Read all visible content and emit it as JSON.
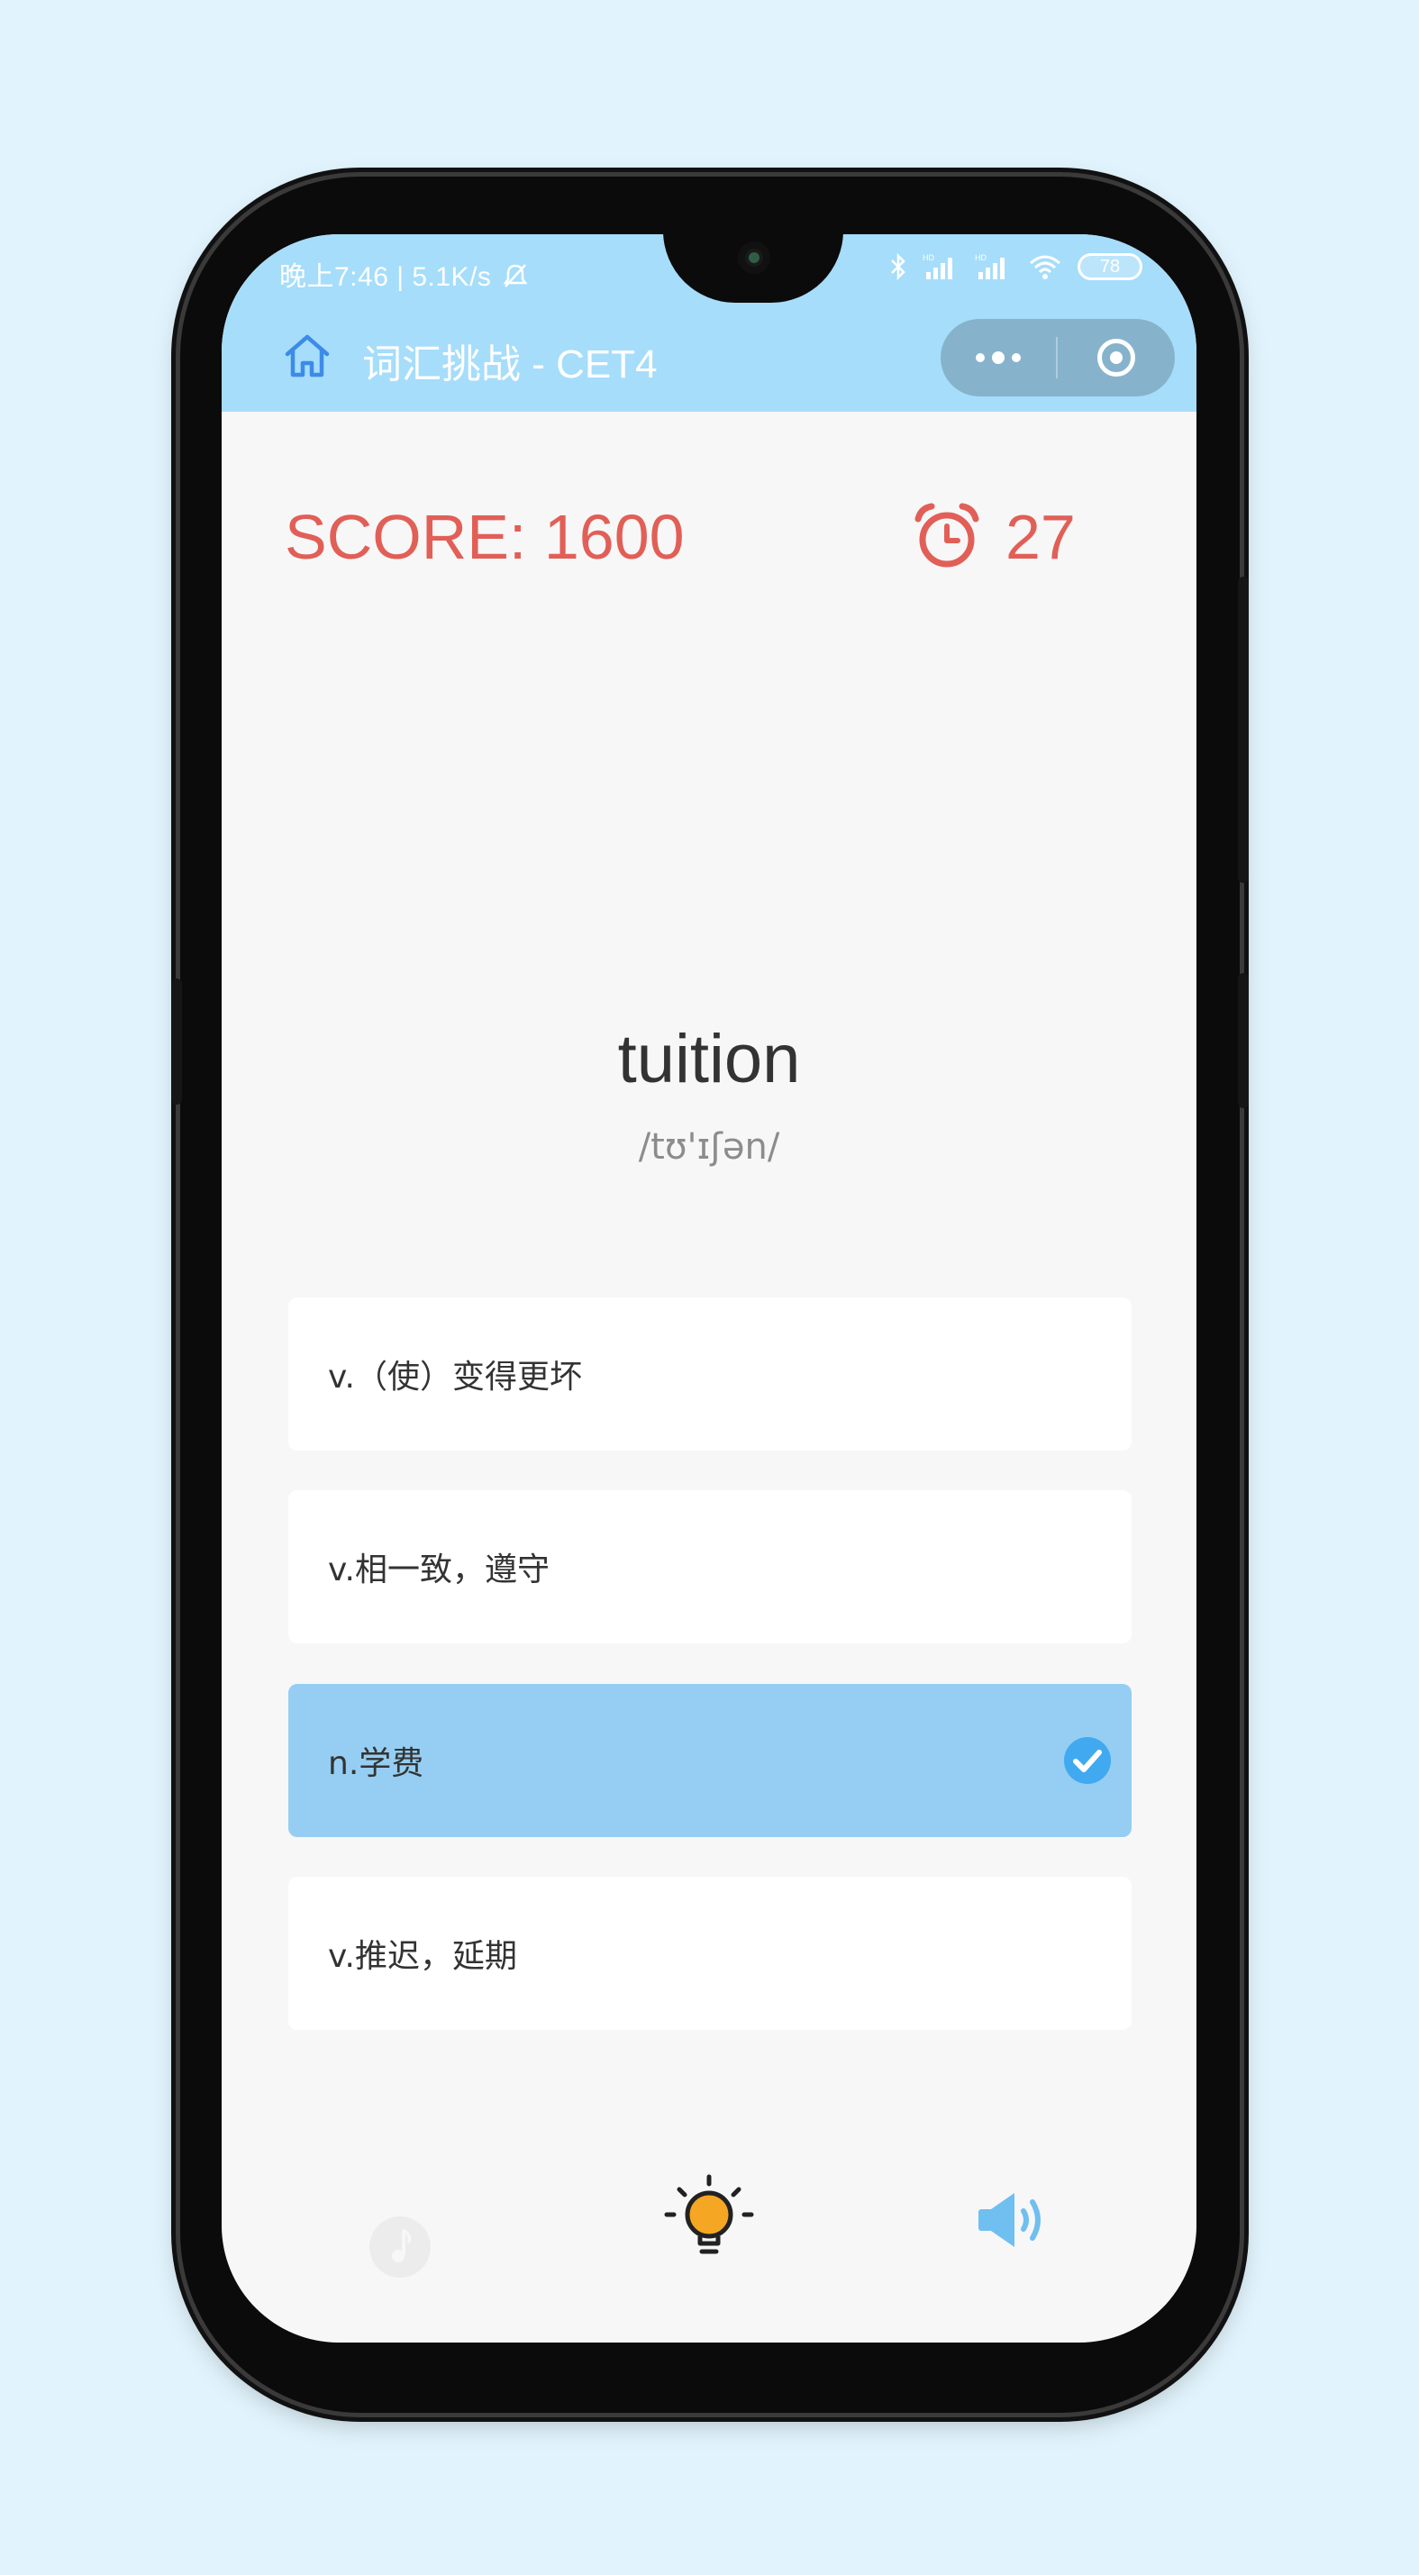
{
  "status_bar": {
    "time_net": "晚上7:46 | 5.1K/s",
    "battery": "78"
  },
  "nav": {
    "title": "词汇挑战 - CET4"
  },
  "game": {
    "score": "SCORE: 1600",
    "timer": "27",
    "word": "tuition",
    "phonetic": "/tʊ'ɪʃən/"
  },
  "options": [
    {
      "label": "v.（使）变得更坏"
    },
    {
      "label": "v.相一致，遵守"
    },
    {
      "label": "n.学费"
    },
    {
      "label": "v.推迟，延期"
    }
  ],
  "colors": {
    "header": "#a6ddfa",
    "score": "#e15f57",
    "selected": "#95cef2",
    "check": "#41a9f0",
    "bulb": "#f5a623",
    "speaker": "#6fbff0"
  }
}
